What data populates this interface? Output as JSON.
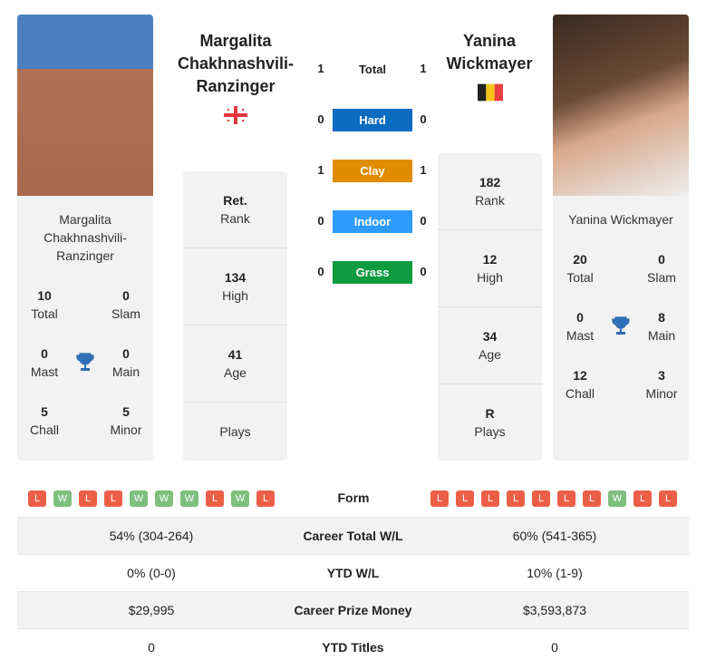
{
  "p1": {
    "name": "Margalita Chakhnashvili-Ranzinger",
    "name_lines": [
      "Margalita",
      "Chakhnashvili-",
      "Ranzinger"
    ],
    "flag": "georgia-flag",
    "titles": {
      "total": "10",
      "slam": "0",
      "mast": "0",
      "main": "0",
      "chall": "5",
      "minor": "5"
    },
    "rank": "Ret.",
    "high": "134",
    "age": "41",
    "plays": "",
    "form": [
      "L",
      "W",
      "L",
      "L",
      "W",
      "W",
      "W",
      "L",
      "W",
      "L"
    ],
    "career_wl": "54% (304-264)",
    "ytd_wl": "0% (0-0)",
    "prize": "$29,995",
    "ytd_titles": "0"
  },
  "p2": {
    "name": "Yanina Wickmayer",
    "name_lines": [
      "Yanina",
      "Wickmayer"
    ],
    "flag": "belgium-flag",
    "titles": {
      "total": "20",
      "slam": "0",
      "mast": "0",
      "main": "8",
      "chall": "12",
      "minor": "3"
    },
    "rank": "182",
    "high": "12",
    "age": "34",
    "plays": "R",
    "form": [
      "L",
      "L",
      "L",
      "L",
      "L",
      "L",
      "L",
      "W",
      "L",
      "L"
    ],
    "career_wl": "60% (541-365)",
    "ytd_wl": "10% (1-9)",
    "prize": "$3,593,873",
    "ytd_titles": "0"
  },
  "labels": {
    "total": "Total",
    "slam": "Slam",
    "mast": "Mast",
    "main": "Main",
    "chall": "Chall",
    "minor": "Minor",
    "rank": "Rank",
    "high": "High",
    "age": "Age",
    "plays": "Plays",
    "form": "Form",
    "career_wl": "Career Total W/L",
    "ytd_wl": "YTD W/L",
    "prize": "Career Prize Money",
    "ytd_titles": "YTD Titles"
  },
  "h2h": [
    {
      "label": "Total",
      "p1": "1",
      "p2": "1",
      "color": ""
    },
    {
      "label": "Hard",
      "p1": "0",
      "p2": "0",
      "color": "#0a6cc0"
    },
    {
      "label": "Clay",
      "p1": "1",
      "p2": "1",
      "color": "#e08c00"
    },
    {
      "label": "Indoor",
      "p1": "0",
      "p2": "0",
      "color": "#2e9bff"
    },
    {
      "label": "Grass",
      "p1": "0",
      "p2": "0",
      "color": "#0e9a3e"
    }
  ],
  "colors": {
    "win": "#7dbf7d",
    "loss": "#ec5f47",
    "trophy": "#2f6fb5"
  }
}
